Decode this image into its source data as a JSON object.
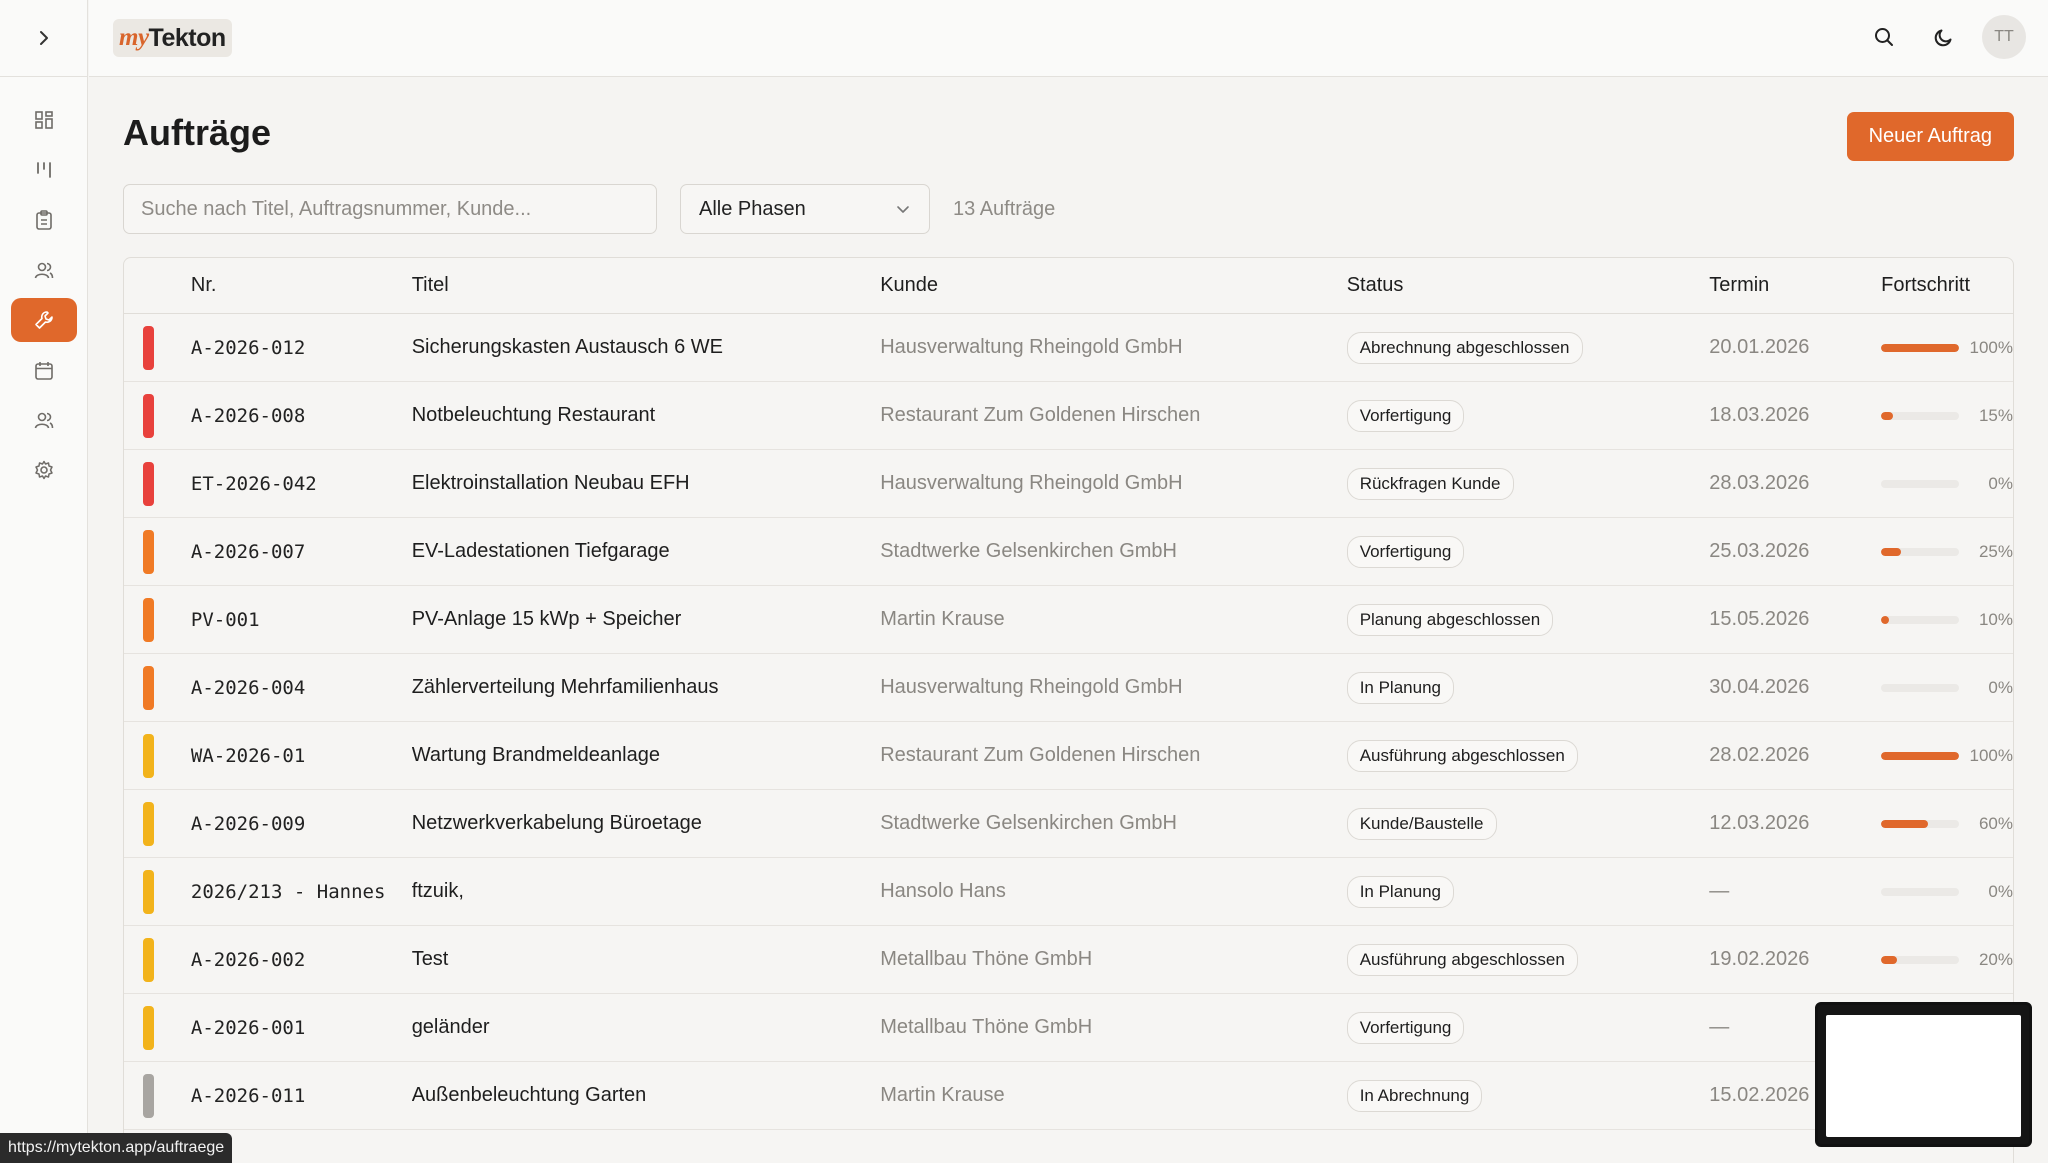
{
  "app": {
    "logo_my": "my",
    "logo_rest": "Tekton",
    "avatar_initials": "TT"
  },
  "sidebar": {
    "items": [
      {
        "icon": "dashboard-icon",
        "active": false
      },
      {
        "icon": "board-icon",
        "active": false
      },
      {
        "icon": "clipboard-icon",
        "active": false
      },
      {
        "icon": "customers-icon",
        "active": false
      },
      {
        "icon": "wrench-icon",
        "active": true
      },
      {
        "icon": "calendar-icon",
        "active": false
      },
      {
        "icon": "team-icon",
        "active": false
      },
      {
        "icon": "settings-icon",
        "active": false
      }
    ]
  },
  "page": {
    "title": "Aufträge",
    "new_button": "Neuer Auftrag",
    "search_placeholder": "Suche nach Titel, Auftragsnummer, Kunde...",
    "phase_filter": "Alle Phasen",
    "count_label": "13 Aufträge"
  },
  "table": {
    "headers": {
      "nr": "Nr.",
      "titel": "Titel",
      "kunde": "Kunde",
      "status": "Status",
      "termin": "Termin",
      "fortschritt": "Fortschritt"
    },
    "rows": [
      {
        "color": "#e8413c",
        "nr": "A-2026-012",
        "titel": "Sicherungskasten Austausch 6 WE",
        "kunde": "Hausverwaltung Rheingold GmbH",
        "status": "Abrechnung abgeschlossen",
        "termin": "20.01.2026",
        "progress": 100,
        "pct": "100%"
      },
      {
        "color": "#e8413c",
        "nr": "A-2026-008",
        "titel": "Notbeleuchtung Restaurant",
        "kunde": "Restaurant Zum Goldenen Hirschen",
        "status": "Vorfertigung",
        "termin": "18.03.2026",
        "progress": 15,
        "pct": "15%"
      },
      {
        "color": "#e8413c",
        "nr": "ET-2026-042",
        "titel": "Elektroinstallation Neubau EFH",
        "kunde": "Hausverwaltung Rheingold GmbH",
        "status": "Rückfragen Kunde",
        "termin": "28.03.2026",
        "progress": 0,
        "pct": "0%"
      },
      {
        "color": "#f07a25",
        "nr": "A-2026-007",
        "titel": "EV-Ladestationen Tiefgarage",
        "kunde": "Stadtwerke Gelsenkirchen GmbH",
        "status": "Vorfertigung",
        "termin": "25.03.2026",
        "progress": 25,
        "pct": "25%"
      },
      {
        "color": "#f07a25",
        "nr": "PV-001",
        "titel": "PV-Anlage 15 kWp + Speicher",
        "kunde": "Martin Krause",
        "status": "Planung abgeschlossen",
        "termin": "15.05.2026",
        "progress": 10,
        "pct": "10%"
      },
      {
        "color": "#f07a25",
        "nr": "A-2026-004",
        "titel": "Zählerverteilung Mehrfamilienhaus",
        "kunde": "Hausverwaltung Rheingold GmbH",
        "status": "In Planung",
        "termin": "30.04.2026",
        "progress": 0,
        "pct": "0%"
      },
      {
        "color": "#f2b31b",
        "nr": "WA-2026-01",
        "titel": "Wartung Brandmeldeanlage",
        "kunde": "Restaurant Zum Goldenen Hirschen",
        "status": "Ausführung abgeschlossen",
        "termin": "28.02.2026",
        "progress": 100,
        "pct": "100%"
      },
      {
        "color": "#f2b31b",
        "nr": "A-2026-009",
        "titel": "Netzwerkverkabelung Büroetage",
        "kunde": "Stadtwerke Gelsenkirchen GmbH",
        "status": "Kunde/Baustelle",
        "termin": "12.03.2026",
        "progress": 60,
        "pct": "60%"
      },
      {
        "color": "#f2b31b",
        "nr": "2026/213 - Hannes",
        "titel": "ftzuik,",
        "kunde": "Hansolo Hans",
        "status": "In Planung",
        "termin": "—",
        "progress": 0,
        "pct": "0%"
      },
      {
        "color": "#f2b31b",
        "nr": "A-2026-002",
        "titel": "Test",
        "kunde": "Metallbau Thöne GmbH",
        "status": "Ausführung abgeschlossen",
        "termin": "19.02.2026",
        "progress": 20,
        "pct": "20%"
      },
      {
        "color": "#f2b31b",
        "nr": "A-2026-001",
        "titel": "geländer",
        "kunde": "Metallbau Thöne GmbH",
        "status": "Vorfertigung",
        "termin": "—",
        "progress": null,
        "pct": ""
      },
      {
        "color": "#a8a5a1",
        "nr": "A-2026-011",
        "titel": "Außenbeleuchtung Garten",
        "kunde": "Martin Krause",
        "status": "In Abrechnung",
        "termin": "15.02.2026",
        "progress": null,
        "pct": ""
      }
    ]
  },
  "status_bar": {
    "url": "https://mytekton.app/auftraege"
  },
  "colors": {
    "accent": "#e0682b",
    "background": "#f5f4f2"
  }
}
